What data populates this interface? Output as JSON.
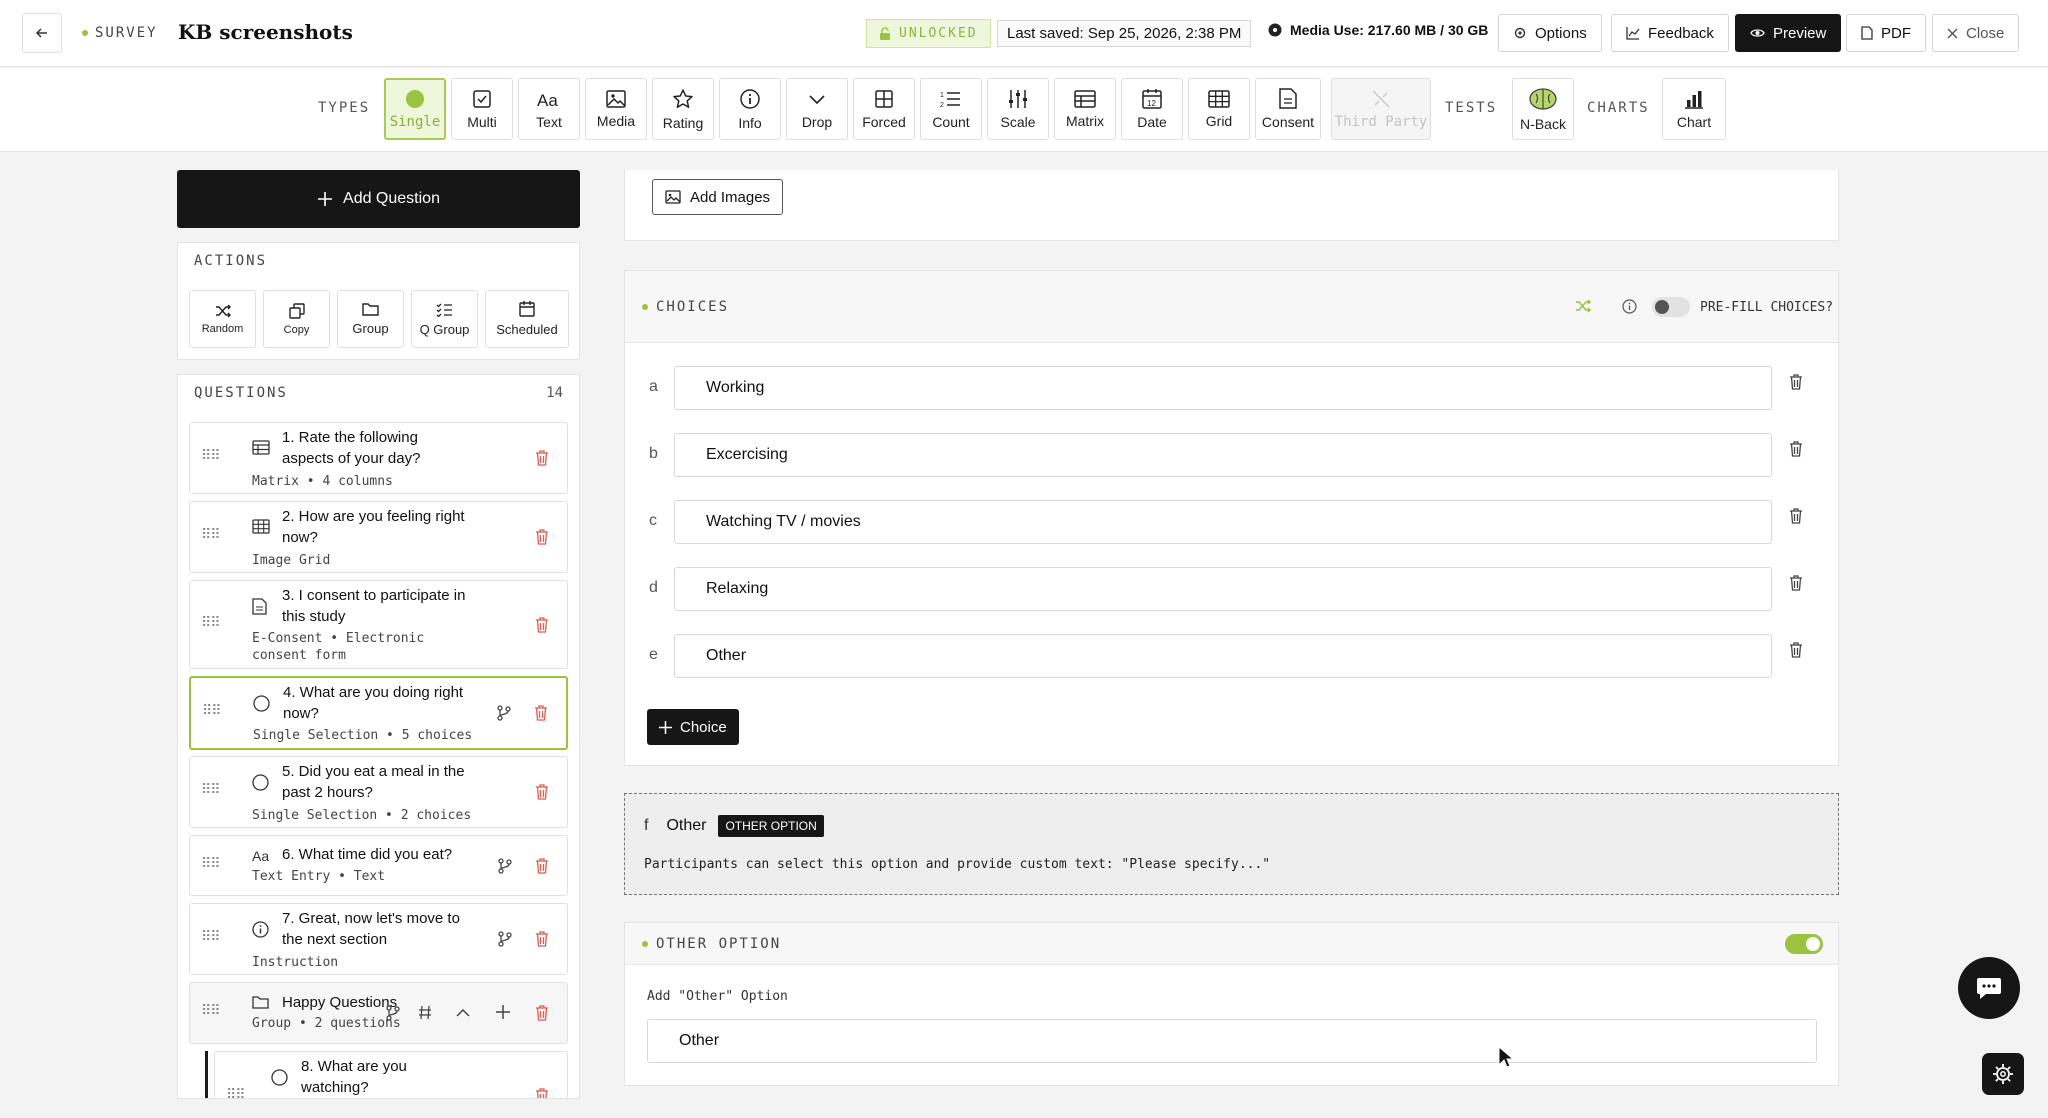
{
  "header": {
    "survey_tag": "SURVEY",
    "title": "KB screenshots",
    "unlocked": "UNLOCKED",
    "last_saved": "Last saved: Sep 25, 2026, 2:38 PM",
    "media_use": "Media Use: 217.60 MB / 30 GB",
    "buttons": {
      "options": "Options",
      "feedback": "Feedback",
      "preview": "Preview",
      "pdf": "PDF",
      "close": "Close"
    }
  },
  "types_bar": {
    "types_label": "TYPES",
    "tests_label": "TESTS",
    "charts_label": "CHARTS",
    "types": [
      "Single",
      "Multi",
      "Text",
      "Media",
      "Rating",
      "Info",
      "Drop",
      "Forced",
      "Count",
      "Scale",
      "Matrix",
      "Date",
      "Grid",
      "Consent",
      "Third Party"
    ],
    "tests": [
      "N-Back"
    ],
    "charts": [
      "Chart"
    ],
    "active": "Single",
    "disabled": "Third Party",
    "date_icon_number": "12"
  },
  "left": {
    "add_question": "Add Question",
    "actions_label": "ACTIONS",
    "actions": [
      "Random",
      "Copy",
      "Group",
      "Q Group",
      "Scheduled"
    ],
    "questions_label": "QUESTIONS",
    "questions_count": "14",
    "questions": [
      {
        "title": "1. Rate the following aspects of your day?",
        "title_l1": "1. Rate the following",
        "title_l2": "aspects of your day?",
        "sub": "Matrix • 4 columns"
      },
      {
        "title_l1": "2. How are you feeling right",
        "title_l2": "now?",
        "sub": "Image Grid"
      },
      {
        "title_l1": "3. I consent to participate in",
        "title_l2": "this study",
        "sub": "E-Consent • Electronic",
        "sub2": "consent form"
      },
      {
        "title_l1": "4. What are you doing right",
        "title_l2": "now?",
        "sub": "Single Selection • 5 choices"
      },
      {
        "title_l1": "5. Did you eat a meal in the",
        "title_l2": "past 2 hours?",
        "sub": "Single Selection • 2 choices"
      },
      {
        "title_l1": "6. What time did you eat?",
        "sub": "Text Entry • Text"
      },
      {
        "title_l1": "7. Great, now let's move to",
        "title_l2": "the next section",
        "sub": "Instruction"
      },
      {
        "title_l1": "Happy Questions",
        "sub": "Group • 2 questions"
      },
      {
        "title_l1": "8. What are you",
        "title_l2": "watching?"
      }
    ]
  },
  "main": {
    "add_images": "Add Images",
    "choices_label": "CHOICES",
    "prefill_label": "PRE-FILL CHOICES?",
    "choices": [
      {
        "letter": "a",
        "value": "Working"
      },
      {
        "letter": "b",
        "value": "Excercising"
      },
      {
        "letter": "c",
        "value": "Watching TV / movies"
      },
      {
        "letter": "d",
        "value": "Relaxing"
      },
      {
        "letter": "e",
        "value": "Other"
      }
    ],
    "add_choice": "Choice",
    "other_preview": {
      "letter": "f",
      "label": "Other",
      "badge": "OTHER OPTION",
      "description": "Participants can select this option and provide custom text: \"Please specify...\""
    },
    "other_option": {
      "label": "OTHER OPTION",
      "enabled": true,
      "field_label": "Add \"Other\" Option",
      "field_value": "Other"
    }
  },
  "colors": {
    "accent": "#9ac33f",
    "dark": "#161616"
  }
}
